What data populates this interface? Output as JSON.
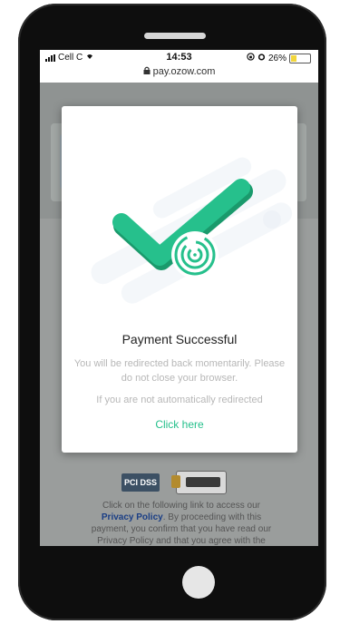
{
  "status_bar": {
    "carrier": "Cell C",
    "time": "14:53",
    "battery": "26%",
    "battery_level": 0.26,
    "url": "pay.ozow.com"
  },
  "modal": {
    "title": "Payment Successful",
    "message": "You will be redirected back momentarily. Please do not close your browser.",
    "fallback_text": "If you are not automatically redirected",
    "link_label": "Click here",
    "accent_color": "#26c08c"
  },
  "footer": {
    "badge_pci": "PCI DSS",
    "legal_text_1": "Click on the following link to access our",
    "privacy_link": "Privacy Policy",
    "legal_text_2": ". By proceeding with this payment, you confirm that you have read our Privacy Policy and that you agree with the"
  }
}
